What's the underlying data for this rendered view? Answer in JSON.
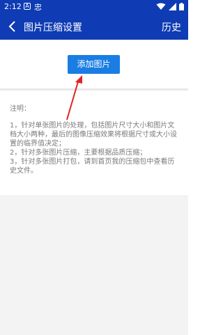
{
  "status_bar": {
    "time": "2:12",
    "indicator_a": "A",
    "indicator_b": "忠"
  },
  "app_bar": {
    "title": "图片压缩设置",
    "history_label": "历史"
  },
  "main": {
    "add_image_label": "添加图片",
    "note_title": "注明：",
    "notes": [
      "1，针对单张图片的处理，包括图片尺寸大小和图片文档大小两种，最后的图像压缩效果将根据尺寸或大小设置的临界值决定；",
      "2，针对多张图片压缩，主要根据品质压缩；",
      "3，针对多张图片打包，请到首页我的压缩包中查看历史文件。"
    ]
  },
  "colors": {
    "primary": "#0f3cb4",
    "button": "#1a7de3",
    "annotation_arrow": "#e02424"
  },
  "icons": {
    "back": "chevron-left-icon",
    "wifi": "wifi-icon",
    "signal": "signal-icon",
    "battery": "battery-icon"
  }
}
